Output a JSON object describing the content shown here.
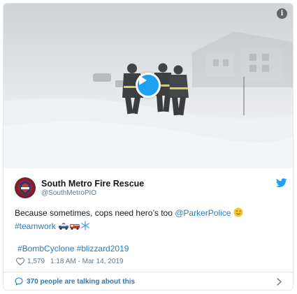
{
  "author": {
    "name": "South Metro Fire Rescue",
    "handle": "@SouthMetroPIO"
  },
  "tweet": {
    "text_before": "Because sometimes, cops need hero’s too ",
    "mention": "@ParkerPolice",
    "hashtag_teamwork": "#teamwork",
    "hashtags": "#BombCyclone #blizzard2019"
  },
  "meta": {
    "like_count": "1,579",
    "timestamp": "1:18 AM - Mar 14, 2019"
  },
  "footer": {
    "talking_label": "370 people are talking about this"
  },
  "media": {
    "info_label": "i"
  },
  "icons": {
    "brand": "twitter-bird-icon",
    "play": "play-icon",
    "like": "heart-icon",
    "reply": "comment-icon",
    "more": "chevron-right-icon"
  },
  "colors": {
    "accent": "#1da1f2",
    "link": "#2b7bb9",
    "secondary_text": "#657786",
    "border": "#e1e8ed"
  }
}
